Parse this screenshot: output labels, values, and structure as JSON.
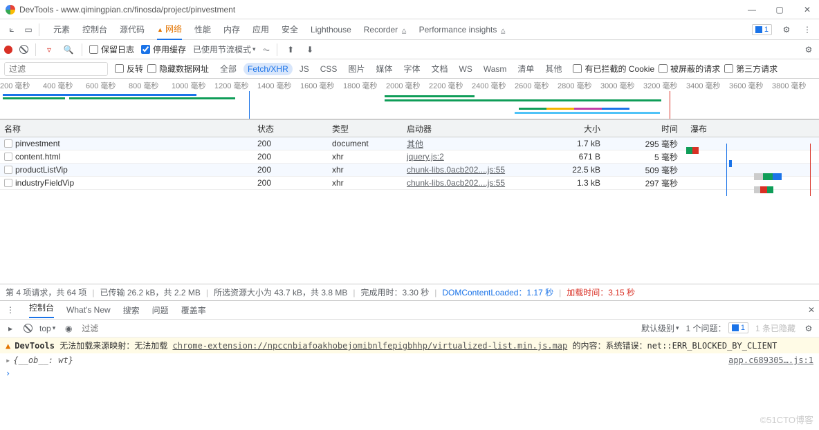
{
  "window": {
    "title": "DevTools - www.qimingpian.cn/finosda/project/pinvestment"
  },
  "tabs": {
    "items": [
      "元素",
      "控制台",
      "源代码",
      "网络",
      "性能",
      "内存",
      "应用",
      "安全",
      "Lighthouse",
      "Recorder",
      "Performance insights"
    ],
    "active_index": 3,
    "issues_count": "1"
  },
  "toolbar": {
    "preserve_log": "保留日志",
    "disable_cache": "停用缓存",
    "throttle": "已使用节流模式"
  },
  "filter": {
    "placeholder": "过滤",
    "invert": "反转",
    "hide_data": "隐藏数据网址",
    "types": [
      "全部",
      "Fetch/XHR",
      "JS",
      "CSS",
      "图片",
      "媒体",
      "字体",
      "文档",
      "WS",
      "Wasm",
      "清单",
      "其他"
    ],
    "selected_type_index": 1,
    "blocked_cookies": "有已拦截的 Cookie",
    "blocked_req": "被屏蔽的请求",
    "third_party": "第三方请求"
  },
  "timeline": {
    "ticks": [
      "200 毫秒",
      "400 毫秒",
      "600 毫秒",
      "800 毫秒",
      "1000 毫秒",
      "1200 毫秒",
      "1400 毫秒",
      "1600 毫秒",
      "1800 毫秒",
      "2000 毫秒",
      "2200 毫秒",
      "2400 毫秒",
      "2600 毫秒",
      "2800 毫秒",
      "3000 毫秒",
      "3200 毫秒",
      "3400 毫秒",
      "3600 毫秒",
      "3800 毫秒"
    ]
  },
  "columns": {
    "name": "名称",
    "status": "状态",
    "type": "类型",
    "initiator": "启动器",
    "size": "大小",
    "time": "时间",
    "waterfall": "瀑布"
  },
  "requests": [
    {
      "name": "pinvestment",
      "status": "200",
      "type": "document",
      "initiator": "其他",
      "size": "1.7 kB",
      "time": "295 毫秒"
    },
    {
      "name": "content.html",
      "status": "200",
      "type": "xhr",
      "initiator": "jquery.js:2",
      "size": "671 B",
      "time": "5 毫秒"
    },
    {
      "name": "productListVip",
      "status": "200",
      "type": "xhr",
      "initiator": "chunk-libs.0acb202....js:55",
      "size": "22.5 kB",
      "time": "509 毫秒"
    },
    {
      "name": "industryFieldVip",
      "status": "200",
      "type": "xhr",
      "initiator": "chunk-libs.0acb202....js:55",
      "size": "1.3 kB",
      "time": "297 毫秒"
    }
  ],
  "summary": {
    "req_text": "第 4 项请求，共 64 项",
    "transfer": "已传输 26.2 kB，共 2.2 MB",
    "resources": "所选资源大小为 43.7 kB，共 3.8 MB",
    "finish": "完成用时：3.30 秒",
    "dcl_label": "DOMContentLoaded：",
    "dcl_val": "1.17 秒",
    "load_label": "加载时间：",
    "load_val": "3.15 秒"
  },
  "drawer": {
    "tabs": [
      "控制台",
      "What's New",
      "搜索",
      "问题",
      "覆盖率"
    ],
    "active": 0,
    "context": "top",
    "level": "默认级别",
    "filter_ph": "过滤",
    "issues": "1 个问题：",
    "issues_count": "1",
    "hidden": "1 条已隐藏"
  },
  "warning": {
    "prefix": "DevTools ",
    "text1": "无法加载来源映射：无法加载 ",
    "url": "chrome-extension://npccnbiafoakhobejomibnlfepigbhhp/virtualized-list.min.js.map",
    "text2": " 的内容：系统错误：net::ERR_BLOCKED_BY_CLIENT"
  },
  "object": "{__ob__: wt}",
  "object_src": "app.c689305….js:1",
  "watermark": "©51CTO博客"
}
